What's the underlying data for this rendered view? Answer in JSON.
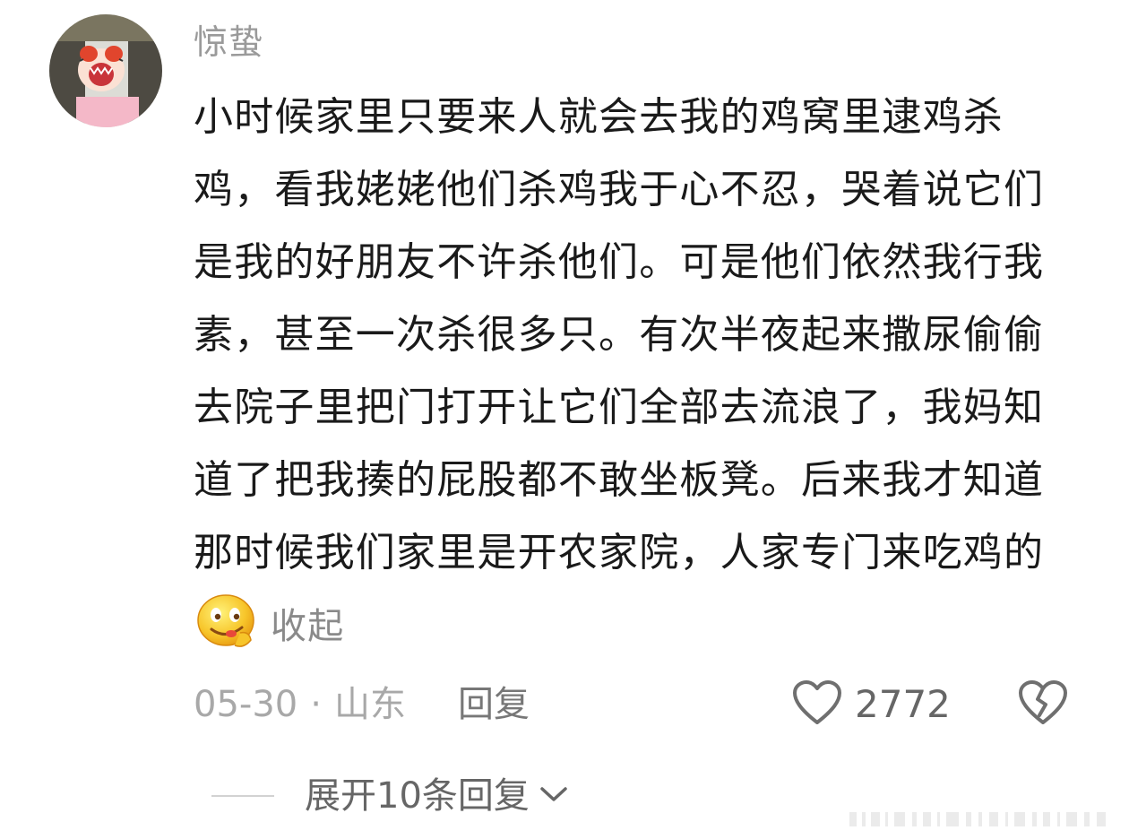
{
  "comment": {
    "username": "惊蛰",
    "text": "小时候家里只要来人就会去我的鸡窝里逮鸡杀鸡，看我姥姥他们杀鸡我于心不忍，哭着说它们是我的好朋友不许杀他们。可是他们依然我行我素，甚至一次杀很多只。有次半夜起来撒尿偷偷去院子里把门打开让它们全部去流浪了，我妈知道了把我揍的屁股都不敢坐板凳。后来我才知道那时候我们家里是开农家院，人家专门来吃鸡的",
    "emoji_icon": "smirk-face-emoji",
    "collapse_label": "收起",
    "date": "05-30",
    "separator": "·",
    "location": "山东",
    "reply_label": "回复",
    "like_count": "2772",
    "like_icon": "heart-outline-icon",
    "dislike_icon": "broken-heart-icon",
    "expand_replies_label": "展开10条回复",
    "expand_icon": "chevron-down-icon"
  },
  "colors": {
    "background": "#ffffff",
    "text_primary": "#1a1a1a",
    "text_secondary": "#9a9a9a",
    "icon_gray": "#6f6f6f",
    "avatar_pink": "#f4b8c8"
  }
}
